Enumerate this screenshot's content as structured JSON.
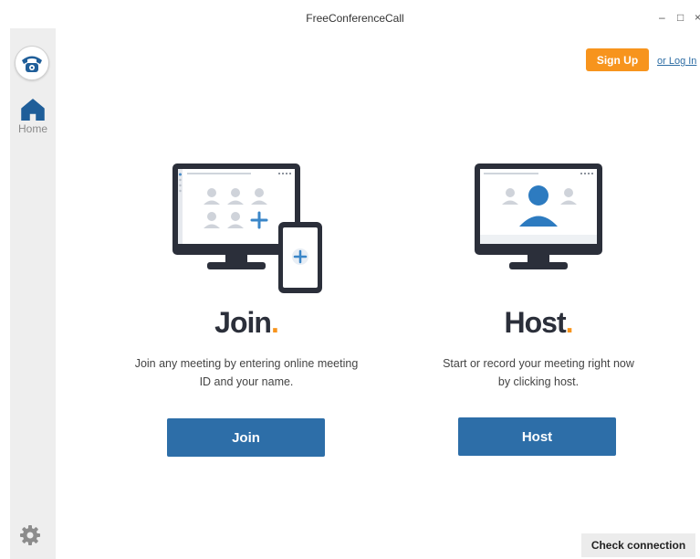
{
  "window": {
    "title": "FreeConferenceCall",
    "minimize_glyph": "–",
    "maximize_glyph": "□",
    "close_glyph": "×"
  },
  "sidebar": {
    "logo_icon": "telephone-logo-icon",
    "items": [
      {
        "label": "Home",
        "icon": "home-icon",
        "active": true
      }
    ],
    "settings_icon": "gear-icon"
  },
  "header": {
    "signup_label": "Sign Up",
    "login_label": "or Log In"
  },
  "join": {
    "heading": "Join",
    "heading_dot": ".",
    "desc_line1": "Join any meeting by entering online meeting",
    "desc_line2": "ID and your name.",
    "button_label": "Join"
  },
  "host": {
    "heading": "Host",
    "heading_dot": ".",
    "desc_line1": "Start or record your meeting right now",
    "desc_line2": "by clicking host.",
    "button_label": "Host"
  },
  "footer": {
    "check_connection_label": "Check connection"
  },
  "colors": {
    "accent_orange": "#f7941d",
    "primary_blue": "#2d6ea8",
    "dark_navy": "#2b2f3a",
    "sidebar_bg": "#eeeeee"
  }
}
